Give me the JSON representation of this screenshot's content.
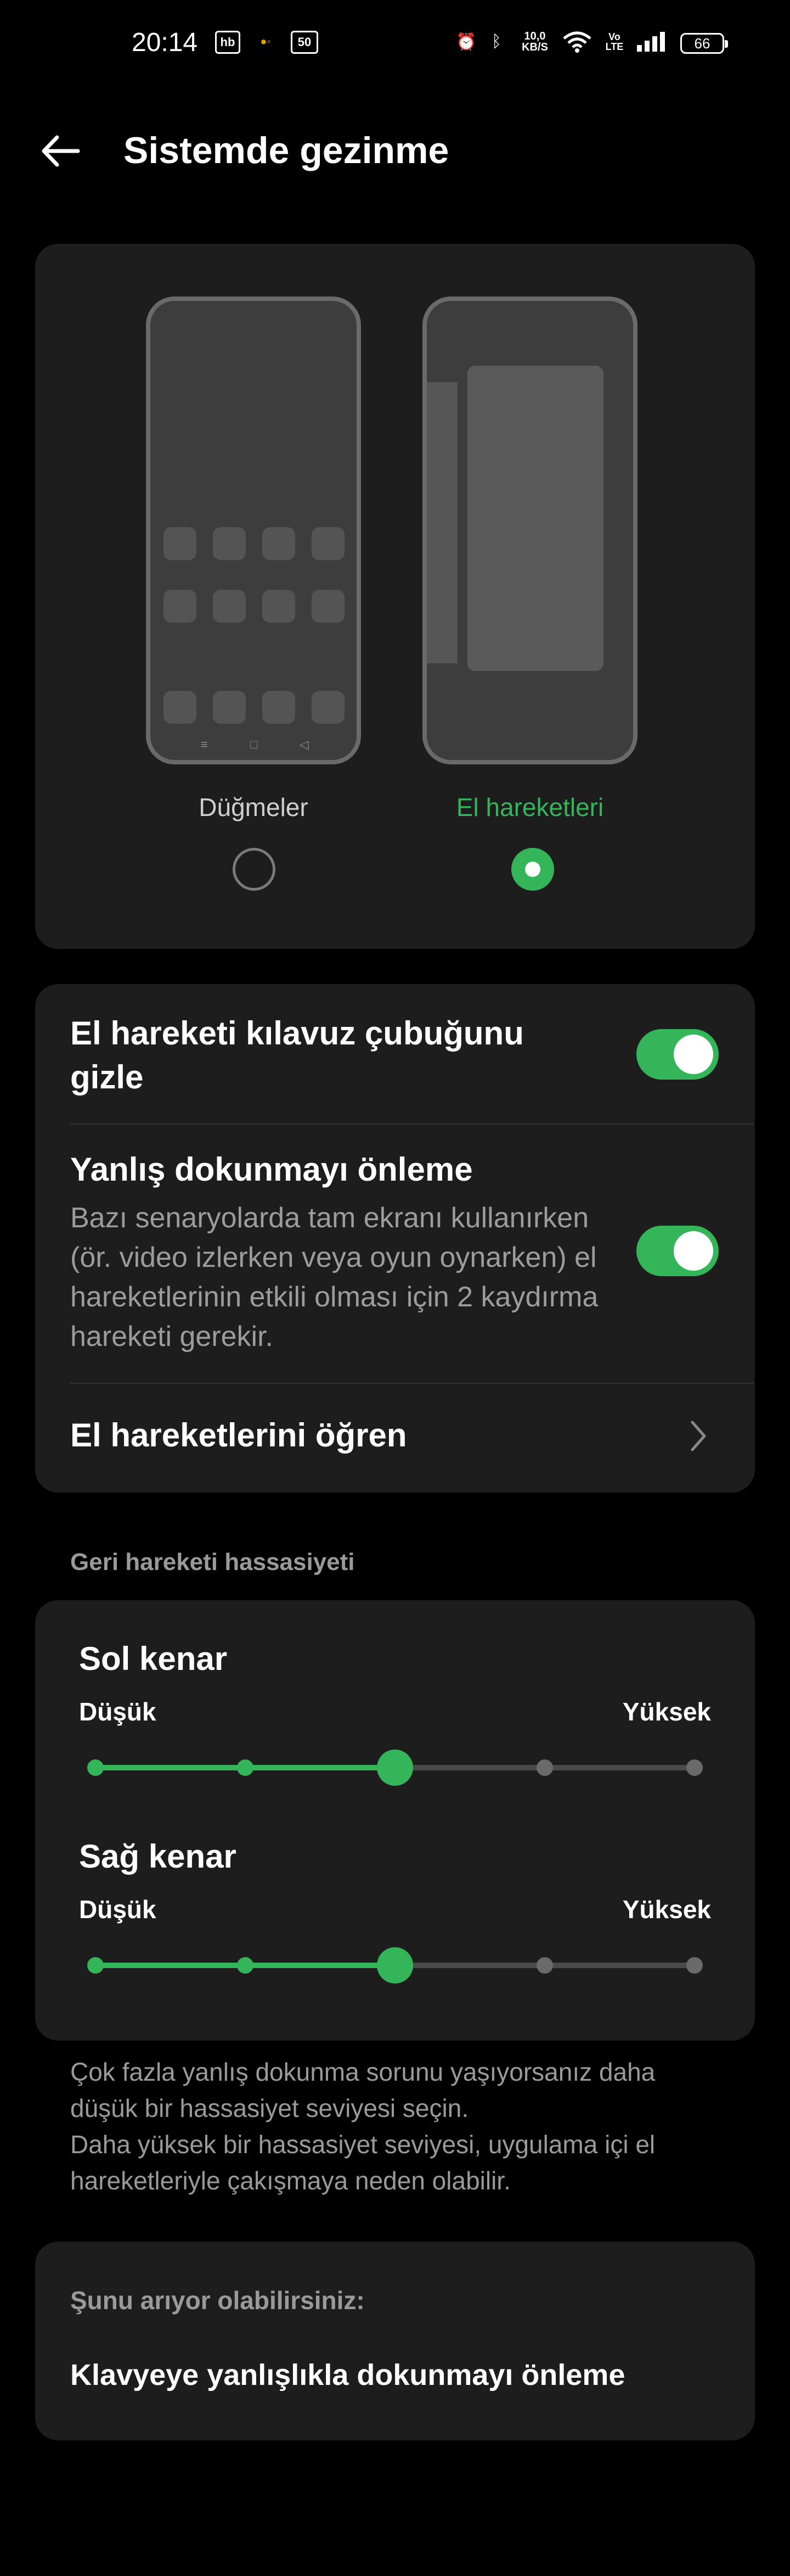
{
  "status_bar": {
    "time": "20:14",
    "net_speed": "10,0\nKB/S",
    "volte": "Vo\nLTE",
    "battery": "66",
    "icons": [
      "hb-icon",
      "game-icon",
      "50-icon",
      "alarm-icon",
      "bluetooth-icon",
      "wifi-icon",
      "signal-icon",
      "battery-icon"
    ]
  },
  "header": {
    "title": "Sistemde gezinme",
    "back_icon": "arrow-left-icon"
  },
  "nav_options": [
    {
      "label": "Düğmeler",
      "selected": false
    },
    {
      "label": "El hareketleri",
      "selected": true
    }
  ],
  "settings": {
    "hide_bar": {
      "title": "El hareketi kılavuz çubuğunu gizle",
      "enabled": true
    },
    "false_touch": {
      "title": "Yanlış dokunmayı önleme",
      "description": "Bazı senaryolarda tam ekranı kullanırken (ör. video izlerken veya oyun oynarken) el hareketlerinin etkili olması için 2 kaydırma hareketi gerekir.",
      "enabled": true
    },
    "learn": {
      "title": "El hareketlerini öğren"
    }
  },
  "sensitivity": {
    "section_label": "Geri hareketi hassasiyeti",
    "left": {
      "title": "Sol kenar",
      "low": "Düşük",
      "high": "Yüksek",
      "level": 2,
      "steps": 5
    },
    "right": {
      "title": "Sağ kenar",
      "low": "Düşük",
      "high": "Yüksek",
      "level": 2,
      "steps": 5
    },
    "hint": "Çok fazla yanlış dokunma sorunu yaşıyorsanız daha düşük bir hassasiyet seviyesi seçin.\nDaha yüksek bir hassasiyet seviyesi, uygulama içi el hareketleriyle çakışmaya neden olabilir."
  },
  "suggestion": {
    "label": "Şunu arıyor olabilirsiniz:",
    "item": "Klavyeye yanlışlıkla dokunmayı önleme"
  },
  "colors": {
    "accent": "#34b55a",
    "card": "#1d1d1d",
    "background": "#000000"
  }
}
